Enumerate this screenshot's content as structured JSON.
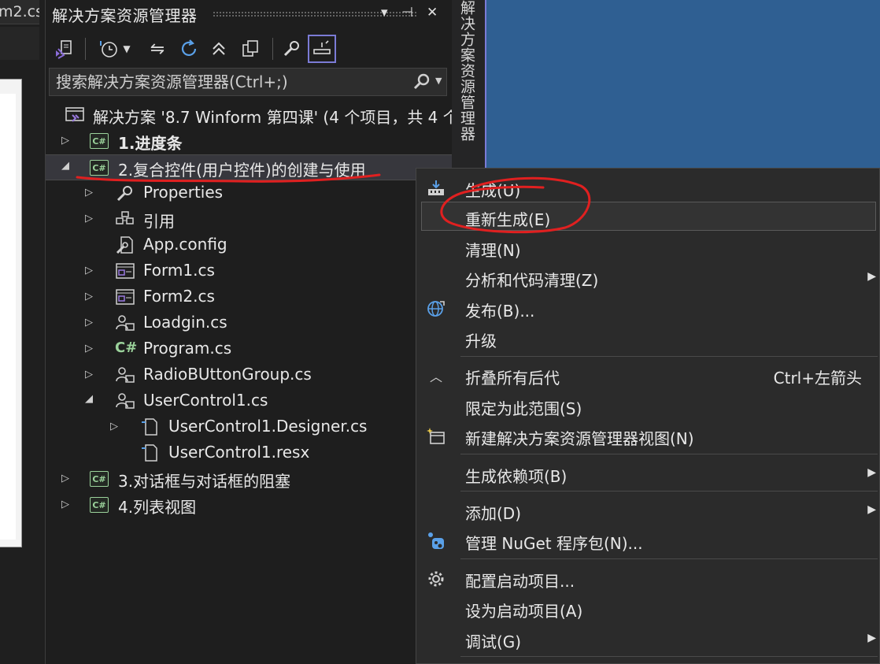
{
  "editor": {
    "tab_label": "m2.cs"
  },
  "panel": {
    "title": "解决方案资源管理器",
    "pin_icon": "pin-icon",
    "close_icon": "close-icon",
    "search_placeholder": "搜索解决方案资源管理器(Ctrl+;)"
  },
  "vertical_tab": "解决方案资源管理器",
  "tree": {
    "solution": "解决方案 '8.7 Winform 第四课' (4 个项目，共 4 个",
    "items": [
      {
        "label": "1.进度条"
      },
      {
        "label": "2.复合控件(用户控件)的创建与使用"
      },
      {
        "label": "Properties"
      },
      {
        "label": "引用"
      },
      {
        "label": "App.config"
      },
      {
        "label": "Form1.cs"
      },
      {
        "label": "Form2.cs"
      },
      {
        "label": "Loadgin.cs"
      },
      {
        "label": "Program.cs"
      },
      {
        "label": "RadioBUttonGroup.cs"
      },
      {
        "label": "UserControl1.cs"
      },
      {
        "label": "UserControl1.Designer.cs"
      },
      {
        "label": "UserControl1.resx"
      },
      {
        "label": "3.对话框与对话框的阻塞"
      },
      {
        "label": "4.列表视图"
      }
    ]
  },
  "context_menu": {
    "items": [
      {
        "label": "生成(U)",
        "icon": "build-icon"
      },
      {
        "label": "重新生成(E)"
      },
      {
        "label": "清理(N)"
      },
      {
        "label": "分析和代码清理(Z)"
      },
      {
        "label": "发布(B)...",
        "icon": "globe-icon"
      },
      {
        "label": "升级"
      },
      {
        "label": "折叠所有后代",
        "shortcut": "Ctrl+左箭头",
        "icon": "collapse-icon"
      },
      {
        "label": "限定为此范围(S)"
      },
      {
        "label": "新建解决方案资源管理器视图(N)",
        "icon": "new-view-icon"
      },
      {
        "label": "生成依赖项(B)"
      },
      {
        "label": "添加(D)"
      },
      {
        "label": "管理 NuGet 程序包(N)...",
        "icon": "nuget-icon"
      },
      {
        "label": "配置启动项目...",
        "icon": "gear-icon"
      },
      {
        "label": "设为启动项目(A)"
      },
      {
        "label": "调试(G)"
      }
    ]
  },
  "colors": {
    "annotation": "#e02020",
    "accent": "#7b7bd6",
    "csharp": "#9bd29b"
  }
}
